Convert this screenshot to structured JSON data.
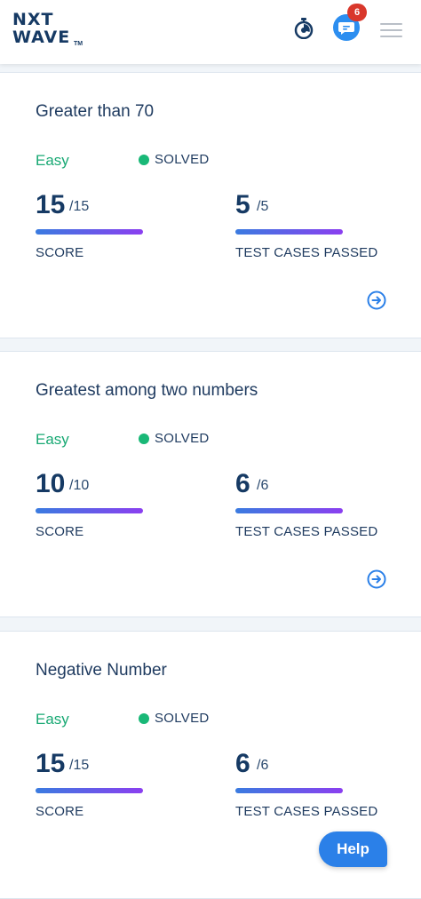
{
  "header": {
    "logo_line1": "NXT",
    "logo_line2": "WAVE",
    "logo_tm": "TM",
    "chat_badge_count": "6",
    "icons": {
      "timer": "stopwatch-icon",
      "chat": "chat-bubble-icon",
      "menu": "hamburger-menu-icon"
    }
  },
  "cards": [
    {
      "title": "Greater than 70",
      "difficulty": "Easy",
      "status": "SOLVED",
      "score_value": "15",
      "score_total": "/15",
      "score_label": "SCORE",
      "tests_value": "5",
      "tests_total": "/5",
      "tests_label": "TEST CASES PASSED"
    },
    {
      "title": "Greatest among two numbers",
      "difficulty": "Easy",
      "status": "SOLVED",
      "score_value": "10",
      "score_total": "/10",
      "score_label": "SCORE",
      "tests_value": "6",
      "tests_total": "/6",
      "tests_label": "TEST CASES PASSED"
    },
    {
      "title": "Negative Number",
      "difficulty": "Easy",
      "status": "SOLVED",
      "score_value": "15",
      "score_total": "/15",
      "score_label": "SCORE",
      "tests_value": "6",
      "tests_total": "/6",
      "tests_label": "TEST CASES PASSED"
    }
  ],
  "help_button_label": "Help",
  "colors": {
    "easy": "#19a974",
    "solved_dot": "#19b877",
    "title": "#1e3a5f",
    "bar_start": "#3a7be0",
    "bar_end": "#8b3ff0",
    "help_bg": "#2b80e8",
    "badge": "#d9372b"
  }
}
